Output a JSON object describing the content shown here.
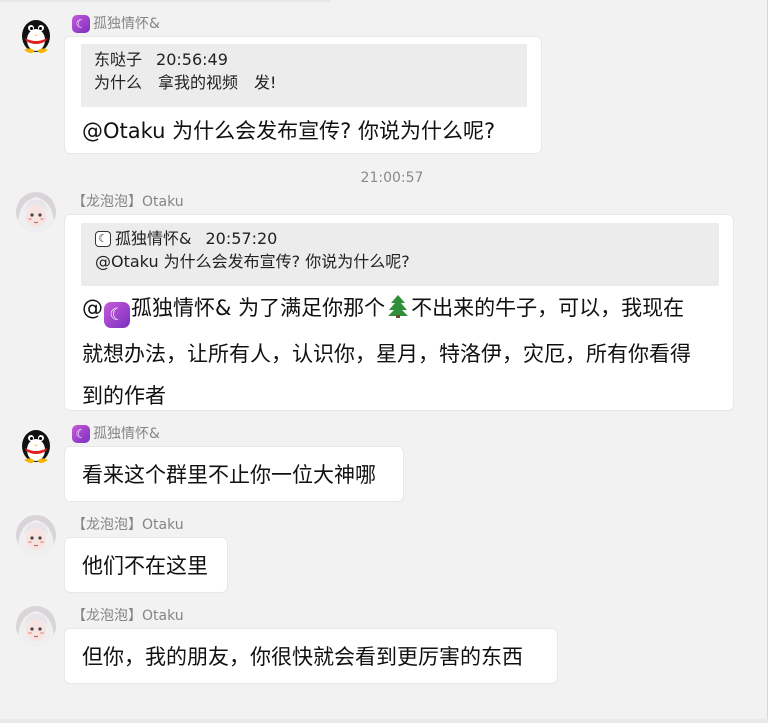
{
  "messages": [
    {
      "sender": "孤独情怀&",
      "quote": {
        "author": "东哒子",
        "time": "20:56:49",
        "text": "为什么　拿我的视频　发!"
      },
      "text": "@Otaku 为什么会发布宣传? 你说为什么呢?"
    },
    {
      "sender": "【龙泡泡】Otaku",
      "quote": {
        "author": "孤独情怀&",
        "time": "20:57:20",
        "text": "@Otaku 为什么会发布宣传? 你说为什么呢?"
      },
      "mention": "@",
      "mention_name": "孤独情怀&",
      "text_line1_a": " 为了满足你那个",
      "text_line1_b": "不出来的牛子，可以，我现在",
      "text_line2": "就想办法，让所有人，认识你，星月，特洛伊，灾厄，所有你看得",
      "text_line3": "到的作者"
    },
    {
      "sender": "孤独情怀&",
      "text": "看来这个群里不止你一位大神哪"
    },
    {
      "sender": "【龙泡泡】Otaku",
      "text": "他们不在这里"
    },
    {
      "sender": "【龙泡泡】Otaku",
      "text": "但你，我的朋友，你很快就会看到更厉害的东西"
    }
  ],
  "time_divider": "21:00:57",
  "icons": {
    "qq_avatar": "penguin-avatar-icon",
    "anime_avatar": "anime-girl-avatar-icon",
    "badge": "crescent-moon-badge-icon",
    "emoji": "tree-emoji-icon"
  },
  "colors": {
    "background": "#f2f2f2",
    "bubble": "#ffffff",
    "quote": "#ececec",
    "sender": "#858585",
    "badge": "#9b40c9"
  }
}
